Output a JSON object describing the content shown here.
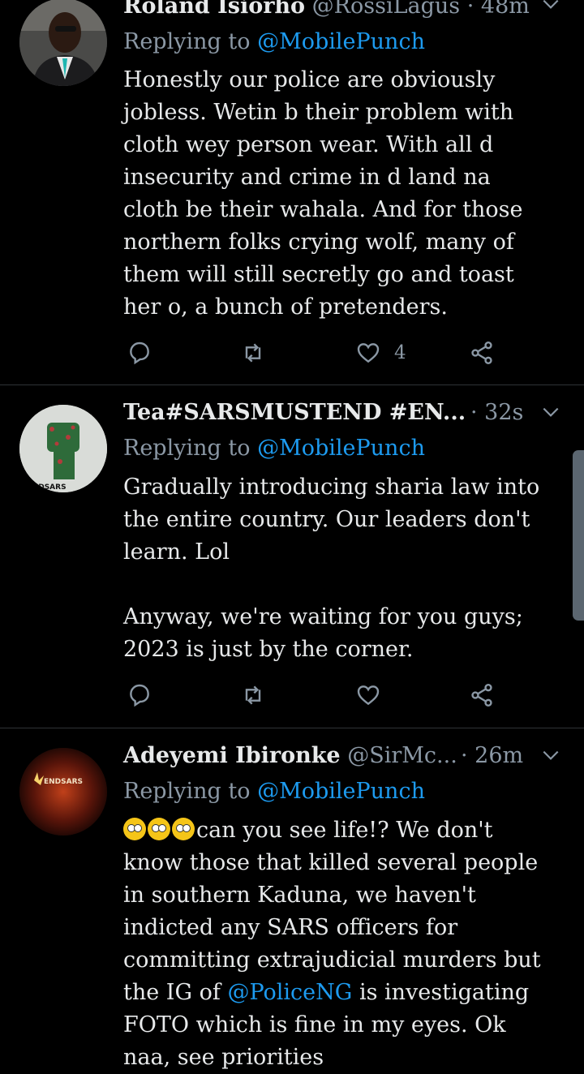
{
  "tweets": [
    {
      "name": "Roland Isiorho",
      "handle": "@RossiLagus",
      "time": "· 48m",
      "replying_prefix": "Replying to ",
      "replying_handle": "@MobilePunch",
      "text": "Honestly our police are obviously\njobless. Wetin b their problem with\ncloth wey person wear. With all d\ninsecurity and crime in d land na\ncloth be their wahala. And for those\nnorthern folks crying wolf, many of\nthem will still secretly go and toast\nher o, a bunch of pretenders.",
      "like_count": "4"
    },
    {
      "name": "Tea#SARSMUSTEND #EN...",
      "handle": "",
      "time": "· 32s",
      "replying_prefix": "Replying to ",
      "replying_handle": "@MobilePunch",
      "text": "Gradually introducing sharia law into\nthe entire country. Our leaders don't\nlearn. Lol\n\nAnyway, we're waiting for you guys;\n2023 is just by the corner.",
      "like_count": "",
      "avatar_text": "#ENDSARS"
    },
    {
      "name": "Adeyemi Ibironke",
      "handle": "@SirMc...",
      "time": "· 26m",
      "replying_prefix": "Replying to ",
      "replying_handle": "@MobilePunch",
      "text_part1": "can you see life!? We don't\nknow those that killed several people\nin southern Kaduna, we haven't\nindicted any SARS officers for\ncommitting extrajudicial murders but\nthe IG of ",
      "text_mention": "@PoliceNG",
      "text_part2": " is investigating\nFOTO which is fine in my eyes. Ok\nnaa, see priorities",
      "avatar_text": "ENDSARS"
    }
  ],
  "icons": {
    "reply": "reply-icon",
    "retweet": "retweet-icon",
    "like": "heart-icon",
    "share": "share-icon",
    "more": "chevron-down-icon"
  },
  "colors": {
    "background": "#000000",
    "text": "#e7e9ea",
    "muted": "#8b98a5",
    "link": "#1d9bf0"
  }
}
